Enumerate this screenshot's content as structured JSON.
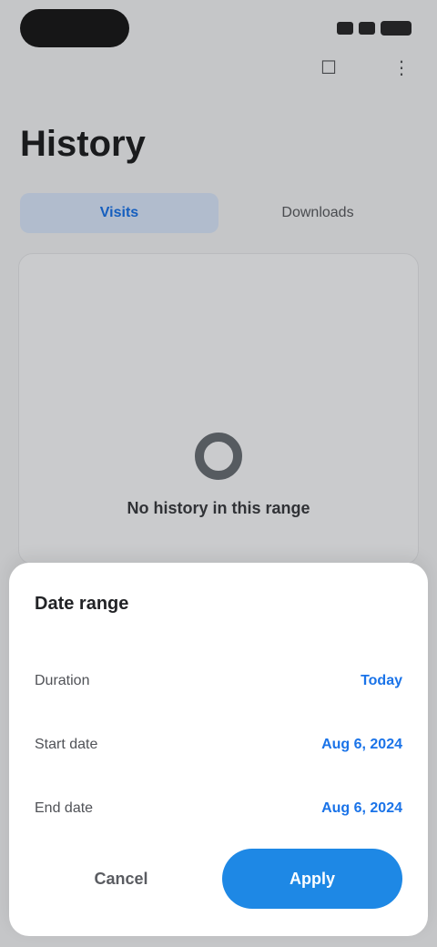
{
  "screen": {
    "title": "History",
    "tabs": [
      {
        "label": "Visits"
      },
      {
        "label": "Downloads"
      }
    ],
    "empty_state_text": "No history in this range",
    "icons": {
      "top_icons": [
        "calendar-icon",
        "more-icon"
      ],
      "empty_icon": "clock-icon"
    }
  },
  "sheet": {
    "title": "Date range",
    "rows": [
      {
        "label": "Duration",
        "value": "Today"
      },
      {
        "label": "Start date",
        "value": "Aug 6, 2024"
      },
      {
        "label": "End date",
        "value": "Aug 6, 2024"
      }
    ],
    "cancel_label": "Cancel",
    "apply_label": "Apply"
  },
  "colors": {
    "accent": "#1e88e5",
    "link": "#1a73e8"
  }
}
